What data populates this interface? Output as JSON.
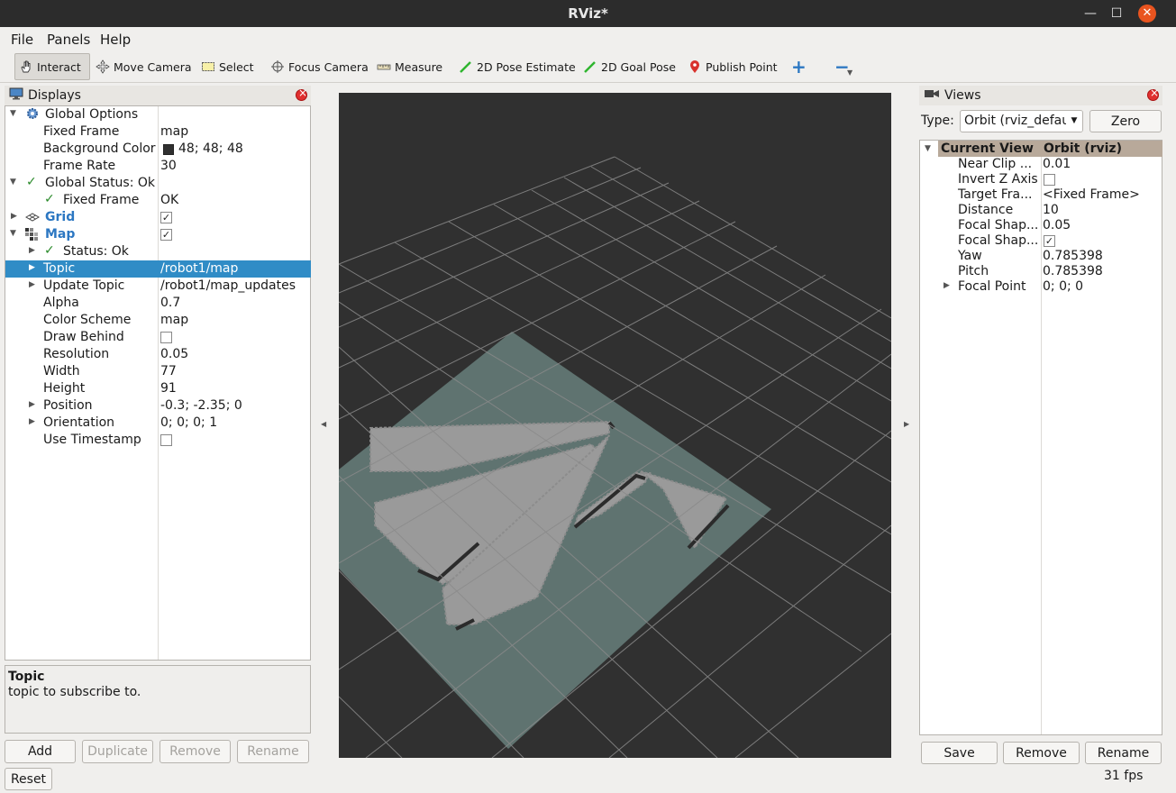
{
  "window": {
    "title": "RViz*"
  },
  "menubar": {
    "file": "File",
    "panels": "Panels",
    "help": "Help"
  },
  "toolbar": {
    "interact": "Interact",
    "move_camera": "Move Camera",
    "select": "Select",
    "focus_camera": "Focus Camera",
    "measure": "Measure",
    "pose_estimate": "2D Pose Estimate",
    "goal_pose": "2D Goal Pose",
    "publish_point": "Publish Point",
    "plus_symbol": "+",
    "minus_symbol": "−"
  },
  "displays": {
    "title": "Displays",
    "rows": {
      "global_options": "Global Options",
      "fixed_frame": {
        "name": "Fixed Frame",
        "value": "map"
      },
      "background_color": {
        "name": "Background Color",
        "value": "48; 48; 48"
      },
      "frame_rate": {
        "name": "Frame Rate",
        "value": "30"
      },
      "global_status": "Global Status: Ok",
      "status_fixed_frame": {
        "name": "Fixed Frame",
        "value": "OK"
      },
      "grid": "Grid",
      "map": "Map",
      "map_status": "Status: Ok",
      "topic": {
        "name": "Topic",
        "value": "/robot1/map"
      },
      "update_topic": {
        "name": "Update Topic",
        "value": "/robot1/map_updates"
      },
      "alpha": {
        "name": "Alpha",
        "value": "0.7"
      },
      "color_scheme": {
        "name": "Color Scheme",
        "value": "map"
      },
      "draw_behind": {
        "name": "Draw Behind"
      },
      "resolution": {
        "name": "Resolution",
        "value": "0.05"
      },
      "width": {
        "name": "Width",
        "value": "77"
      },
      "height": {
        "name": "Height",
        "value": "91"
      },
      "position": {
        "name": "Position",
        "value": "-0.3; -2.35; 0"
      },
      "orientation": {
        "name": "Orientation",
        "value": "0; 0; 0; 1"
      },
      "use_timestamp": {
        "name": "Use Timestamp"
      }
    },
    "description": {
      "title": "Topic",
      "text": "topic to subscribe to."
    },
    "buttons": {
      "add": "Add",
      "duplicate": "Duplicate",
      "remove": "Remove",
      "rename": "Rename"
    },
    "reset": "Reset"
  },
  "views": {
    "title": "Views",
    "type_label": "Type:",
    "type_value": "Orbit (rviz_defau",
    "zero": "Zero",
    "header": {
      "name": "Current View",
      "value": "Orbit (rviz)"
    },
    "rows": {
      "near_clip": {
        "name": "Near Clip ...",
        "value": "0.01"
      },
      "invert_z": {
        "name": "Invert Z Axis"
      },
      "target_frame": {
        "name": "Target Fra...",
        "value": "<Fixed Frame>"
      },
      "distance": {
        "name": "Distance",
        "value": "10"
      },
      "focal_shape_size": {
        "name": "Focal Shap...",
        "value": "0.05"
      },
      "focal_shape_fixed": {
        "name": "Focal Shap..."
      },
      "yaw": {
        "name": "Yaw",
        "value": "0.785398"
      },
      "pitch": {
        "name": "Pitch",
        "value": "0.785398"
      },
      "focal_point": {
        "name": "Focal Point",
        "value": "0; 0; 0"
      }
    },
    "buttons": {
      "save": "Save",
      "remove": "Remove",
      "rename": "Rename"
    }
  },
  "status": {
    "fps": "31 fps"
  },
  "colors": {
    "background": "#303030",
    "map_plane": "#5f7370",
    "free_space": "#9a9a9a",
    "selection": "#308cc6",
    "close_button": "#e9541f"
  },
  "icons": [
    "hand-icon",
    "move-camera-icon",
    "select-icon",
    "focus-camera-icon",
    "measure-icon",
    "pose-estimate-icon",
    "goal-pose-icon",
    "publish-point-icon",
    "gear-icon",
    "grid-icon",
    "map-icon",
    "camera-icon",
    "check-icon"
  ]
}
